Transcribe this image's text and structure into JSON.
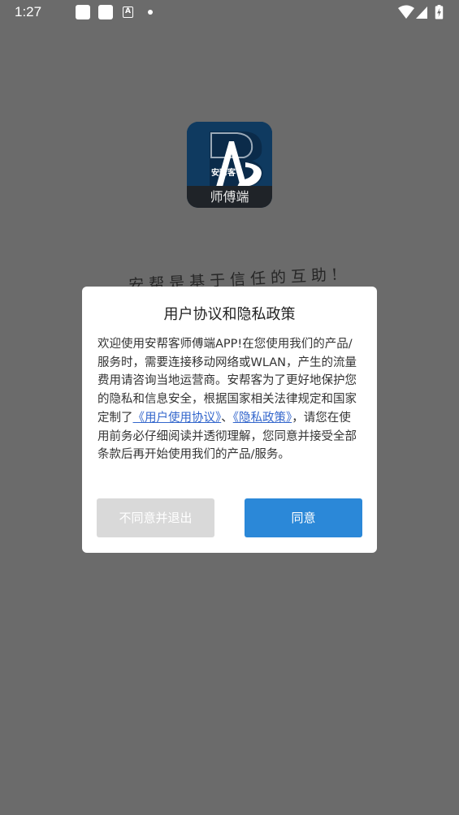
{
  "status_bar": {
    "time": "1:27",
    "notification_icons": [
      "square-notification-icon",
      "square-notification-icon",
      "a-notification-icon",
      "dot-icon"
    ],
    "right_icons": [
      "wifi-icon",
      "cellular-signal-icon",
      "battery-charging-icon"
    ],
    "a_glyph": "A"
  },
  "splash": {
    "logo_text": "师傅端",
    "logo_brand": "安帮客",
    "slogan": "安帮是基于信任的互助!"
  },
  "dialog": {
    "title": "用户协议和隐私政策",
    "body_intro": "欢迎使用安帮客师傅端APP!在您使用我们的产品/服务时，需要连接移动网络或WLAN，产生的流量费用请咨询当地运营商。安帮客为了更好地保护您的隐私和信息安全，根据国家相关法律规定和国家定制了",
    "link_user_agreement": "《用户使用协议》",
    "separator": "、",
    "link_privacy_policy": "《隐私政策》",
    "body_outro": "，请您在使用前务必仔细阅读并透彻理解，您同意并接受全部条款后再开始使用我们的产品/服务。",
    "disagree_label": "不同意并退出",
    "agree_label": "同意"
  },
  "colors": {
    "overlay": "#6b6b6b",
    "agree_button": "#2b88d8",
    "disagree_button": "#d9d9d9",
    "link": "#3366cc",
    "logo_blue": "#0f3a60"
  }
}
